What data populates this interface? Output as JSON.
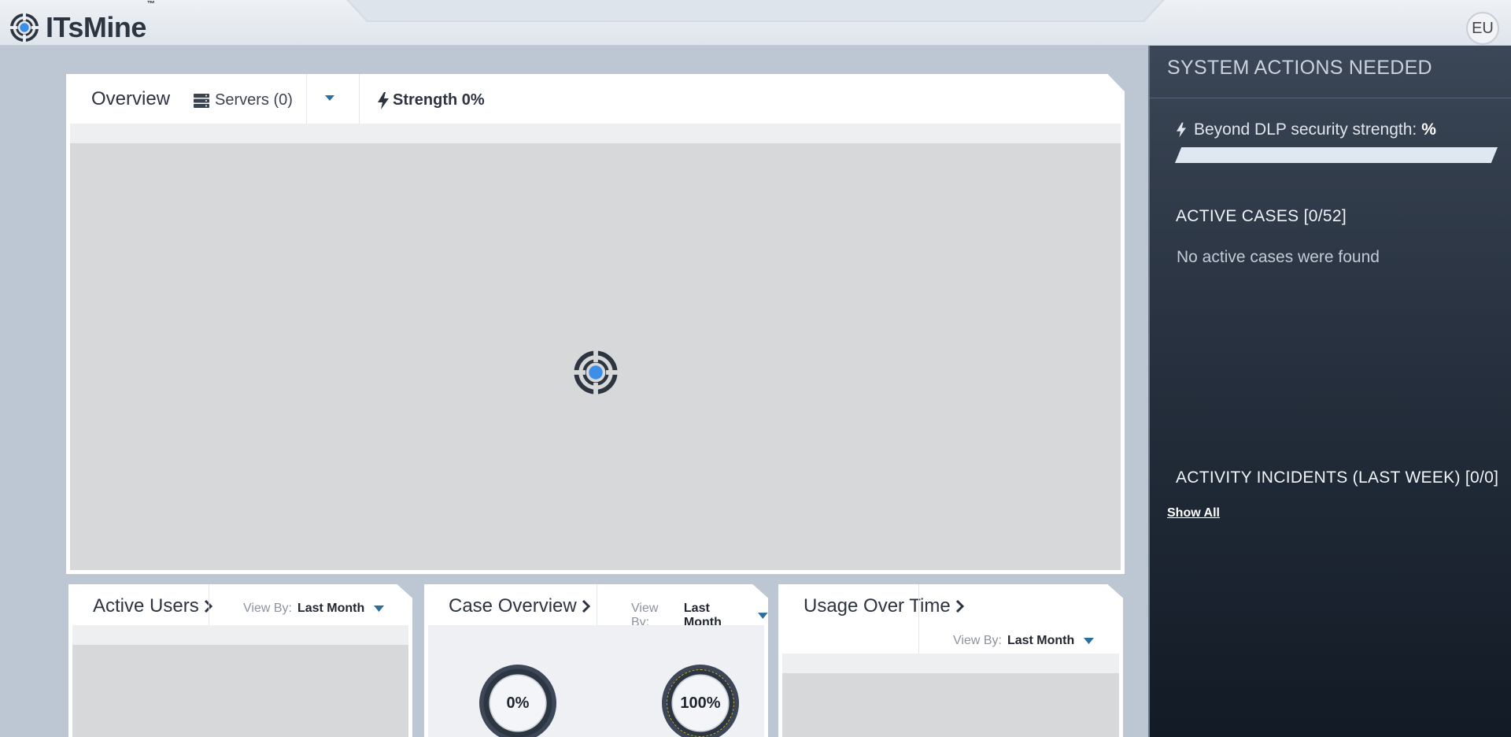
{
  "app": {
    "name": "ITsMine",
    "trademark": "™",
    "user_initials": "EU"
  },
  "overview": {
    "title": "Overview",
    "servers_label": "Servers (0)",
    "strength_label": "Strength 0%"
  },
  "side_panel": {
    "title": "SYSTEM ACTIONS NEEDED",
    "strength_label": "Beyond DLP security strength:",
    "strength_value": "%",
    "strength_fill_fraction": 0,
    "active_cases_heading": "ACTIVE CASES [0/52]",
    "active_cases_empty": "No active cases were found",
    "incidents_heading": "ACTIVITY INCIDENTS (LAST WEEK) [0/0]",
    "show_all_label": "Show All"
  },
  "cards": {
    "active_users": {
      "title": "Active Users",
      "viewby_label": "View By:",
      "viewby_value": "Last Month"
    },
    "case_overview": {
      "title": "Case Overview",
      "viewby_label": "View By:",
      "viewby_value": "Last Month",
      "donut_left": "0%",
      "donut_right": "100%"
    },
    "usage_over_time": {
      "title": "Usage Over Time",
      "viewby_label": "View By:",
      "viewby_value": "Last Month"
    }
  },
  "colors": {
    "accent_blue": "#3d8ee8",
    "panel_dark": "#26303e",
    "dropdown_caret": "#2b6f9c"
  },
  "icons": {
    "logo": "itsmine-target-logo",
    "servers": "server-stack-icon",
    "strength": "lightning-bolt-icon",
    "dropdown": "caret-down-icon",
    "card_link": "chevron-right-icon",
    "loading": "loading-target-spinner"
  }
}
